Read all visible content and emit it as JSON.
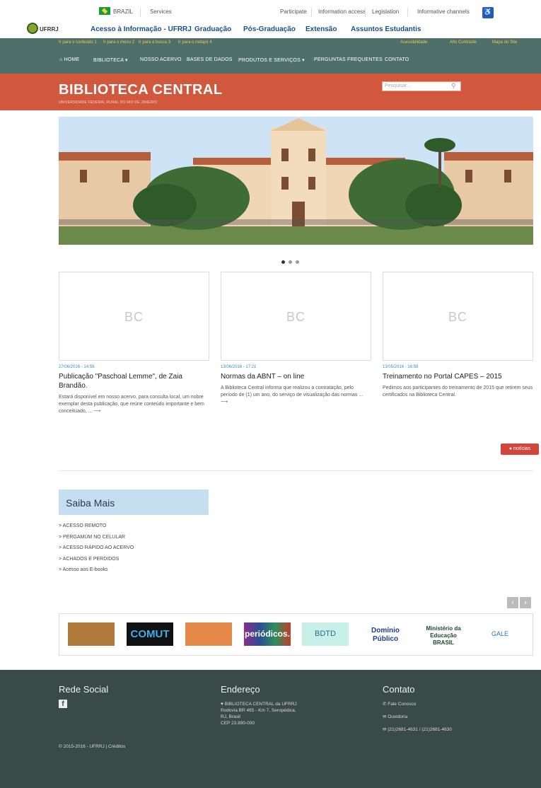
{
  "gov_bar": {
    "brazil": "BRAZIL",
    "services": "Services",
    "participate": "Participate",
    "information_access": "Information access",
    "legislation": "Legislation",
    "informative_channels": "Informative channels"
  },
  "univ_bar": {
    "logo_text": "UFRRJ",
    "links": [
      "Acesso à Informação - UFRRJ",
      "Graduação",
      "Pós-Graduação",
      "Extensão",
      "Assuntos Estudantis"
    ]
  },
  "access_bar": {
    "skip_links": [
      "Ir para o conteúdo 1",
      "Ir para o menu 2",
      "Ir para a busca 3",
      "Ir para o rodapé 4"
    ],
    "right_links": [
      "Acessibilidade",
      "Alto Contraste",
      "Mapa do Site"
    ]
  },
  "nav": {
    "items": [
      "HOME",
      "BIBLIOTECA ▾",
      "NOSSO ACERVO",
      "BASES DE DADOS",
      "PRODUTOS E SERVIÇOS ▾",
      "PERGUNTAS FREQUENTES",
      "CONTATO"
    ]
  },
  "header": {
    "title": "BIBLIOTECA CENTRAL",
    "subtitle": "UNIVERSIDADE FEDERAL RURAL DO RIO DE JANEIRO",
    "search_placeholder": "Pesquisar..."
  },
  "news": [
    {
      "thumb": "BC",
      "date": "27/06/2016 - 14:59",
      "title": "Publicação \"Paschoal Lemme\", de Zaia Brandão.",
      "body": "Estará disponível em nosso acervo, para consulta local, um nobre exemplar desta publicação, que reúne conteúdo importante e bem conceituado, ... ⟶"
    },
    {
      "thumb": "BC",
      "date": "13/06/2016 - 17:21",
      "title": "Normas da ABNT – on line",
      "body": "A Biblioteca Central informa que realizou a contratação, pelo período de (1) um ano, do serviço de visualização das normas ... ⟶"
    },
    {
      "thumb": "BC",
      "date": "13/05/2016 - 16:58",
      "title": "Treinamento no Portal CAPES – 2015",
      "body": "Pedimos aos participantes do treinamento de 2015 que retirem seus certificados na Biblioteca Central."
    }
  ],
  "noticias_button": "notícias",
  "saiba_mais": {
    "title": "Saiba Mais",
    "links": [
      "> ACESSO REMOTO",
      "> PERGAMUM NO CELULAR",
      "> ACESSO RÁPIDO AO ACERVO",
      "> ACHADOS E PERDIDOS",
      "> Acesso aos E-books"
    ]
  },
  "partners": [
    "COMUT",
    "periódicos.",
    "BDTD",
    "Domínio Público",
    "Ministério da Educação BRASIL",
    "GALE"
  ],
  "footer": {
    "social_title": "Rede Social",
    "address_title": "Endereço",
    "address_lines": [
      "♥ BIBLIOTECA CENTRAL da UFRRJ",
      "Rodovia BR 465 - Km 7, Seropédica,",
      "RJ, Brasil",
      "CEP 23.890-000"
    ],
    "contact_title": "Contato",
    "contact_lines": [
      "Fale Conosco",
      "Ouvidoria",
      "(21)2681-4631 / (21)2681-4630"
    ],
    "copyright": "© 2015-2016 - UFRRJ | Créditos"
  },
  "colors": {
    "accent": "#d1573d",
    "nav": "#4f6f6b",
    "footer": "#3a4a49"
  }
}
